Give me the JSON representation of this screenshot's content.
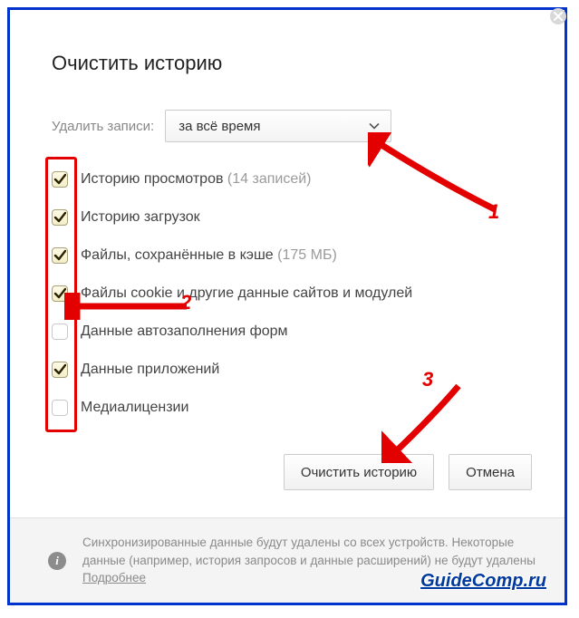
{
  "title": "Очистить историю",
  "delete_label": "Удалить записи:",
  "select_value": "за всё время",
  "items": [
    {
      "label": "Историю просмотров ",
      "suffix": "(14 записей)",
      "checked": true
    },
    {
      "label": "Историю загрузок",
      "suffix": "",
      "checked": true
    },
    {
      "label": "Файлы, сохранённые в кэше ",
      "suffix": "(175 МБ)",
      "checked": true
    },
    {
      "label": "Файлы cookie и другие данные сайтов и модулей",
      "suffix": "",
      "checked": true
    },
    {
      "label": "Данные автозаполнения форм",
      "suffix": "",
      "checked": false
    },
    {
      "label": "Данные приложений",
      "suffix": "",
      "checked": true
    },
    {
      "label": "Медиалицензии",
      "suffix": "",
      "checked": false
    }
  ],
  "buttons": {
    "clear": "Очистить историю",
    "cancel": "Отмена"
  },
  "footer": {
    "text": "Синхронизированные данные будут удалены со всех устройств. Некоторые данные (например, история запросов и данные расширений) не будут удалены ",
    "link": "Подробнее"
  },
  "annotations": {
    "n1": "1",
    "n2": "2",
    "n3": "3"
  },
  "watermark": "GuideComp.ru"
}
